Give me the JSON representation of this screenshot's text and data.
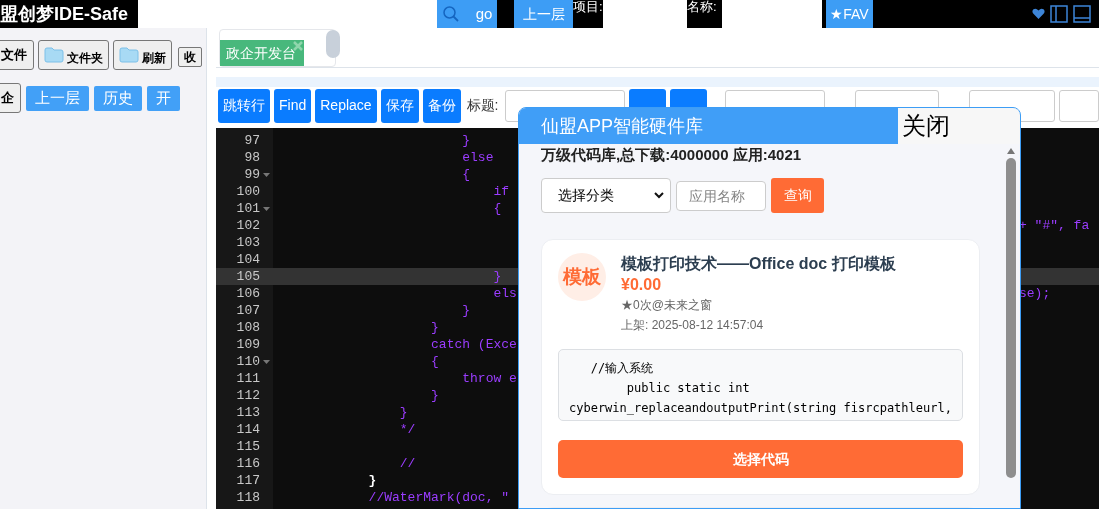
{
  "top_bar": {
    "title": "盟创梦IDE-Safe",
    "search_button": "go",
    "up_button": "上一层",
    "project_label": "项目:",
    "name_label": "名称:",
    "fav_button": "★FAV"
  },
  "sidebar": {
    "file_buttons": [
      {
        "kind": "plain",
        "label": "文件"
      },
      {
        "kind": "folder",
        "label": "文件夹"
      },
      {
        "kind": "folder",
        "label": "刷新"
      },
      {
        "kind": "small",
        "label": "收"
      }
    ],
    "nav_buttons": [
      {
        "kind": "plain",
        "label": "企"
      },
      {
        "kind": "blue",
        "label": "上一层"
      },
      {
        "kind": "blue",
        "label": "历史"
      },
      {
        "kind": "blue",
        "label": "开"
      }
    ]
  },
  "tabs": [
    {
      "label": "政企开发台",
      "selected": true
    }
  ],
  "toolbar": {
    "buttons": [
      "跳转行",
      "Find",
      "Replace",
      "保存",
      "备份"
    ],
    "title_label": "标题:"
  },
  "editor": {
    "lines": [
      {
        "number": "97",
        "code": "                        }",
        "fold": false,
        "current": false,
        "highlight": false
      },
      {
        "number": "98",
        "code": "                        else",
        "fold": false,
        "current": false,
        "highlight": false
      },
      {
        "number": "99",
        "code": "                        {",
        "fold": true,
        "current": false,
        "highlight": false
      },
      {
        "number": "100",
        "code": "                            if",
        "fold": false,
        "current": false,
        "highlight": false
      },
      {
        "number": "101",
        "code": "                            {",
        "fold": true,
        "current": false,
        "highlight": false
      },
      {
        "number": "102",
        "tail": "+ \"#\", fa",
        "fold": false,
        "current": false
      },
      {
        "number": "103",
        "fold": false,
        "current": false
      },
      {
        "number": "104",
        "fold": false,
        "current": false
      },
      {
        "number": "105",
        "code": "                            }",
        "fold": false,
        "current": true,
        "highlight": false
      },
      {
        "number": "106",
        "code": "                            els",
        "tail": "se);",
        "fold": false,
        "current": false,
        "highlight": false
      },
      {
        "number": "107",
        "code": "                        }",
        "fold": false,
        "current": false,
        "highlight": false
      },
      {
        "number": "108",
        "code": "                    }",
        "fold": false,
        "current": false,
        "highlight": false
      },
      {
        "number": "109",
        "code": "                    catch (Exce",
        "fold": false,
        "current": false,
        "highlight": false
      },
      {
        "number": "110",
        "code": "                    {",
        "fold": true,
        "current": false,
        "highlight": false
      },
      {
        "number": "111",
        "code": "                        throw e",
        "fold": false,
        "current": false,
        "highlight": false
      },
      {
        "number": "112",
        "code": "                    }",
        "fold": false,
        "current": false,
        "highlight": false
      },
      {
        "number": "113",
        "code": "                }",
        "fold": false,
        "current": false,
        "highlight": false
      },
      {
        "number": "114",
        "code": "                */",
        "fold": false,
        "current": false,
        "highlight": false
      },
      {
        "number": "115",
        "fold": false,
        "current": false
      },
      {
        "number": "116",
        "code": "                //",
        "fold": false,
        "current": false,
        "highlight": false
      },
      {
        "number": "117",
        "code": "            }",
        "fold": false,
        "current": false,
        "highlight": true
      },
      {
        "number": "118",
        "code": "            //WaterMark(doc, \"",
        "fold": false,
        "current": false,
        "highlight": false
      }
    ]
  },
  "dialog": {
    "title": "仙盟APP智能硬件库",
    "close": "关闭",
    "summary": "万级代码库,总下载:4000000 应用:4021",
    "category_select": "选择分类",
    "app_name_placeholder": "应用名称",
    "query_button": "查询",
    "cards": [
      {
        "avatar": "模板",
        "title": "模板打印技术——Office doc 打印模板",
        "price": "¥0.00",
        "stats": "★0次@未来之窗",
        "listed": "上架: 2025-08-12 14:57:04",
        "code_preview": "   //输入系统\n        public static int\ncyberwin_replaceandoutputPrint(string fisrcpathleurl,",
        "action": "选择代码"
      }
    ]
  }
}
